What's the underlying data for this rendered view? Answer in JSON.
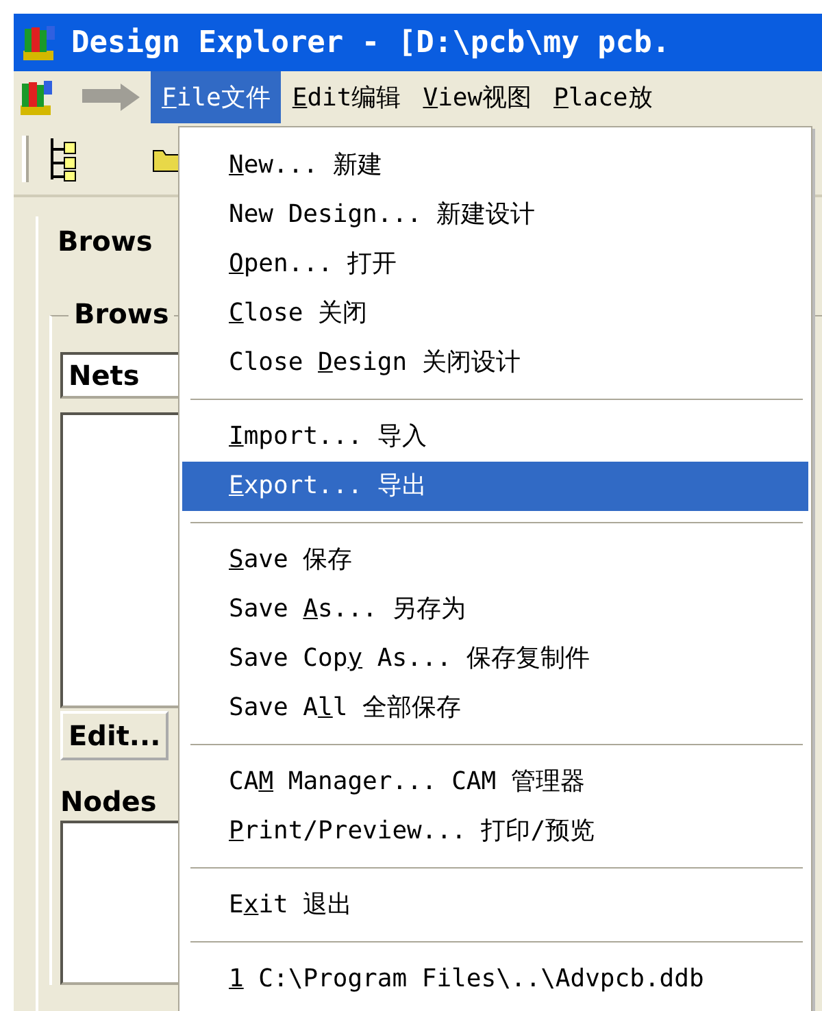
{
  "window": {
    "title": "Design Explorer - [D:\\pcb\\my pcb."
  },
  "menu_bar": [
    {
      "key": "F",
      "after": "ile文件",
      "selected": true
    },
    {
      "key": "E",
      "after": "dit编辑",
      "selected": false
    },
    {
      "key": "V",
      "after": "iew视图",
      "selected": false
    },
    {
      "key": "P",
      "after": "lace放",
      "selected": false
    }
  ],
  "panel": {
    "tab": "Brows",
    "group": "Brows",
    "combo": "Nets",
    "edit_button": "Edit...",
    "nodes_label": "Nodes"
  },
  "file_menu": [
    [
      {
        "key": "N",
        "after": "ew... 新建",
        "selected": false
      },
      {
        "before": "New Design... 新建设计",
        "selected": false
      },
      {
        "key": "O",
        "after": "pen... 打开",
        "selected": false
      },
      {
        "key": "C",
        "after": "lose 关闭",
        "selected": false
      },
      {
        "before": "Close ",
        "key": "D",
        "after": "esign 关闭设计",
        "selected": false
      }
    ],
    [
      {
        "key": "I",
        "after": "mport... 导入",
        "selected": false
      },
      {
        "key": "E",
        "after": "xport... 导出",
        "selected": true
      }
    ],
    [
      {
        "key": "S",
        "after": "ave 保存",
        "selected": false
      },
      {
        "before": "Save ",
        "key": "A",
        "after": "s... 另存为",
        "selected": false
      },
      {
        "before": "Save Cop",
        "key": "y",
        "after": " As... 保存复制件",
        "selected": false
      },
      {
        "before": "Save A",
        "key": "l",
        "after": "l 全部保存",
        "selected": false
      }
    ],
    [
      {
        "before": "CA",
        "key": "M",
        "after": " Manager... CAM 管理器",
        "selected": false
      },
      {
        "key": "P",
        "after": "rint/Preview... 打印/预览",
        "selected": false
      }
    ],
    [
      {
        "before": "E",
        "key": "x",
        "after": "it 退出",
        "selected": false
      }
    ],
    [
      {
        "key": "1",
        "after": " C:\\Program Files\\..\\Advpcb.ddb",
        "selected": false
      }
    ]
  ]
}
